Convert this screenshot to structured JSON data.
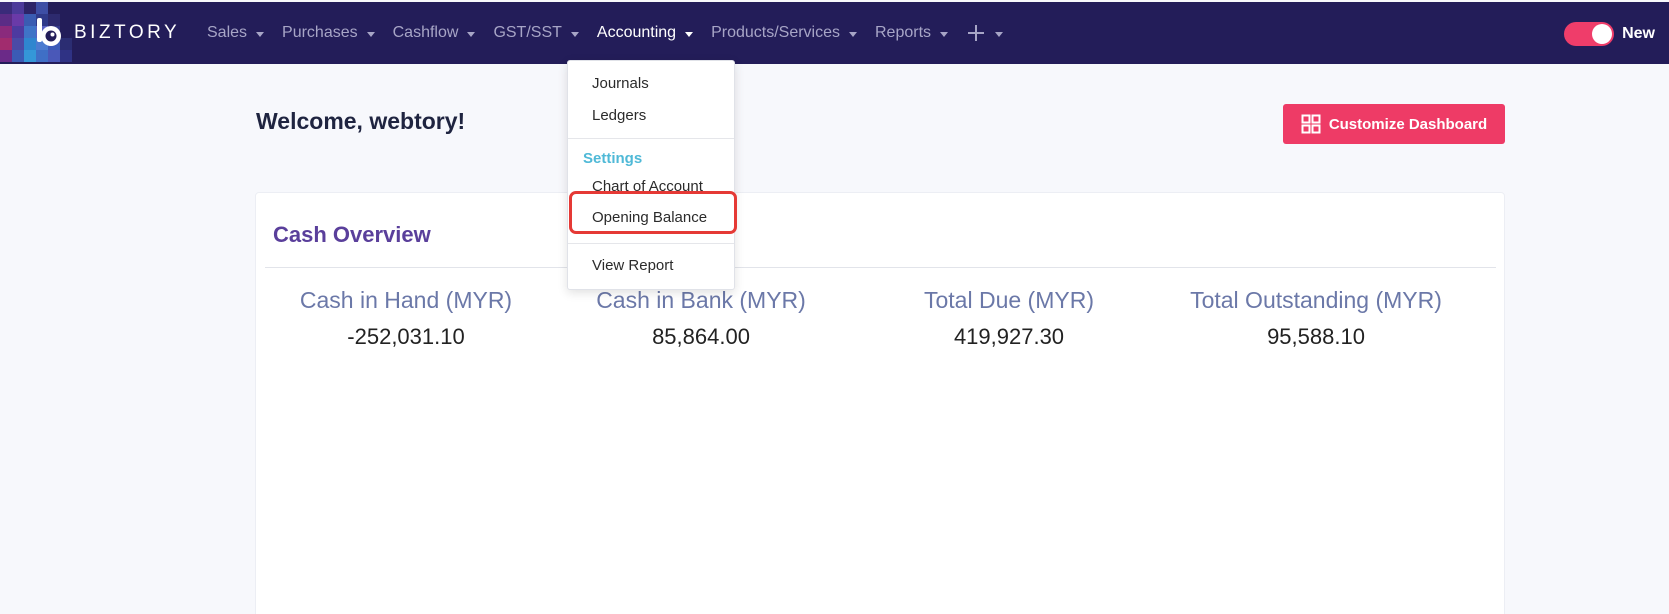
{
  "brand": {
    "name": "BIZTORY",
    "logo_icon": "biztory-logo-icon"
  },
  "nav": {
    "items": [
      {
        "label": "Sales",
        "has_caret": true
      },
      {
        "label": "Purchases",
        "has_caret": true
      },
      {
        "label": "Cashflow",
        "has_caret": true
      },
      {
        "label": "GST/SST",
        "has_caret": true
      },
      {
        "label": "Accounting",
        "has_caret": true,
        "active": true
      },
      {
        "label": "Products/Services",
        "has_caret": true
      },
      {
        "label": "Reports",
        "has_caret": true
      }
    ],
    "plus_icon": "plus-icon",
    "toggle_label": "New"
  },
  "dashboard": {
    "welcome": "Welcome, webtory!",
    "customize_label": "Customize Dashboard",
    "customize_icon": "grid-icon"
  },
  "cash_overview": {
    "title": "Cash Overview",
    "stats": [
      {
        "label": "Cash in Hand (MYR)",
        "value": "-252,031.10"
      },
      {
        "label": "Cash in Bank (MYR)",
        "value": "85,864.00"
      },
      {
        "label": "Total Due (MYR)",
        "value": "419,927.30"
      },
      {
        "label": "Total Outstanding (MYR)",
        "value": "95,588.10"
      }
    ]
  },
  "accounting_menu": {
    "journals": "Journals",
    "ledgers": "Ledgers",
    "settings_header": "Settings",
    "chart_of_account": "Chart of Account",
    "opening_balance": "Opening Balance",
    "view_report": "View Report"
  },
  "colors": {
    "navbar": "#231d59",
    "accent": "#ee3b66",
    "card_title": "#5a3f9b",
    "settings_header": "#4fb9d7",
    "highlight": "#e53935"
  }
}
